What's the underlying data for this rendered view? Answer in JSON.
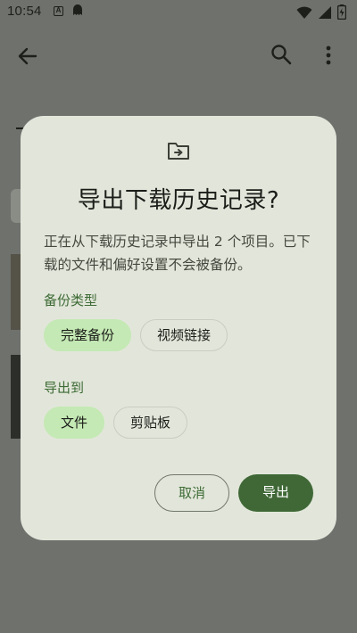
{
  "status_bar": {
    "time": "10:54",
    "app_icon_a": "A",
    "icons": [
      "wifi-icon",
      "signal-icon",
      "battery-icon"
    ]
  },
  "toolbar": {
    "icons": [
      "back-arrow-icon",
      "search-icon",
      "more-vert-icon"
    ]
  },
  "dialog": {
    "icon": "folder-export-icon",
    "title": "导出下载历史记录?",
    "body": "正在从下载历史记录中导出 2 个项目。已下载的文件和偏好设置不会被备份。",
    "backup_type": {
      "label": "备份类型",
      "chips": [
        {
          "label": "完整备份",
          "selected": true
        },
        {
          "label": "视频链接",
          "selected": false
        }
      ]
    },
    "export_to": {
      "label": "导出到",
      "chips": [
        {
          "label": "文件",
          "selected": true
        },
        {
          "label": "剪贴板",
          "selected": false
        }
      ]
    },
    "buttons": {
      "cancel": "取消",
      "export": "导出"
    }
  },
  "colors": {
    "scrim_background": "#6f716d",
    "dialog_surface": "#e2e6da",
    "accent": "#3f6836",
    "chip_selected": "#c4e9b4",
    "label_text": "#3d6b35"
  }
}
